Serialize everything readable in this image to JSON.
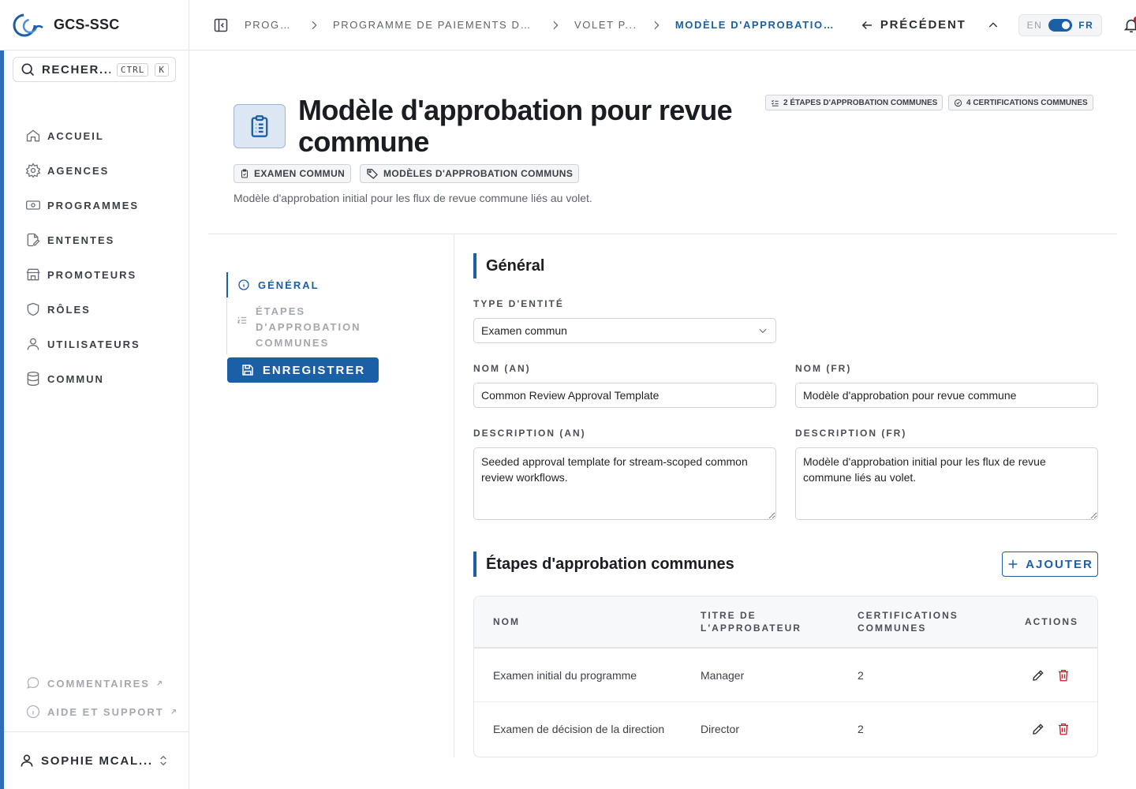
{
  "brand": {
    "name": "GCS-SSC"
  },
  "search": {
    "label": "RECHER...",
    "kbd_ctrl": "CTRL",
    "kbd_k": "K"
  },
  "nav": {
    "items": [
      {
        "label": "ACCUEIL",
        "icon": "home-icon"
      },
      {
        "label": "AGENCES",
        "icon": "gear-icon"
      },
      {
        "label": "PROGRAMMES",
        "icon": "banknote-icon"
      },
      {
        "label": "ENTENTES",
        "icon": "document-edit-icon"
      },
      {
        "label": "PROMOTEURS",
        "icon": "store-icon"
      },
      {
        "label": "RÔLES",
        "icon": "shield-icon"
      },
      {
        "label": "UTILISATEURS",
        "icon": "user-icon"
      },
      {
        "label": "COMMUN",
        "icon": "database-icon"
      }
    ]
  },
  "footer": {
    "comments": "COMMENTAIRES",
    "help": "AIDE ET SUPPORT"
  },
  "user": {
    "name": "SOPHIE MCAL..."
  },
  "breadcrumb": {
    "items": [
      "PROGR...",
      "PROGRAMME DE PAIEMENTS DE TR...",
      "VOLET P...",
      "MODÈLE D'APPROBATION P..."
    ]
  },
  "topbar": {
    "previous": "PRÉCÉDENT",
    "lang_en": "EN",
    "lang_fr": "FR"
  },
  "header": {
    "title": "Modèle d'approbation pour revue commune",
    "description": "Modèle d'approbation initial pour les flux de revue commune liés au volet.",
    "chip_type": "EXAMEN COMMUN",
    "chip_category": "MODÈLES D'APPROBATION COMMUNS",
    "count_steps": "2 ÉTAPES D'APPROBATION COMMUNES",
    "count_certs": "4 CERTIFICATIONS COMMUNES"
  },
  "section_nav": {
    "general": "GÉNÉRAL",
    "steps": "ÉTAPES D'APPROBATION COMMUNES",
    "save": "ENREGISTRER"
  },
  "form": {
    "section_title": "Général",
    "entity_type_label": "TYPE D'ENTITÉ",
    "entity_type_value": "Examen commun",
    "name_en_label": "NOM (AN)",
    "name_en_value": "Common Review Approval Template",
    "name_fr_label": "NOM (FR)",
    "name_fr_value": "Modèle d'approbation pour revue commune",
    "desc_en_label": "DESCRIPTION (AN)",
    "desc_en_value": "Seeded approval template for stream-scoped common review workflows.",
    "desc_fr_label": "DESCRIPTION (FR)",
    "desc_fr_value": "Modèle d'approbation initial pour les flux de revue commune liés au volet."
  },
  "steps": {
    "title": "Étapes d'approbation communes",
    "add": "AJOUTER",
    "columns": [
      "NOM",
      "TITRE DE L'APPROBATEUR",
      "CERTIFICATIONS COMMUNES",
      "ACTIONS"
    ],
    "rows": [
      {
        "name": "Examen initial du programme",
        "approver": "Manager",
        "certs": "2"
      },
      {
        "name": "Examen de décision de la direction",
        "approver": "Director",
        "certs": "2"
      }
    ]
  },
  "colors": {
    "accent": "#1b5fa6",
    "danger": "#d0192b",
    "notification": "#e0142b"
  }
}
